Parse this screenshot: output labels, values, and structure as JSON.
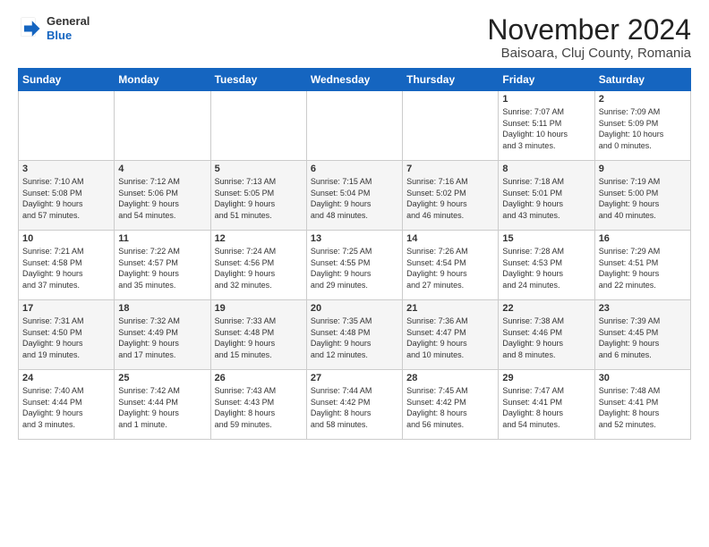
{
  "logo": {
    "line1": "General",
    "line2": "Blue"
  },
  "title": "November 2024",
  "subtitle": "Baisoara, Cluj County, Romania",
  "weekdays": [
    "Sunday",
    "Monday",
    "Tuesday",
    "Wednesday",
    "Thursday",
    "Friday",
    "Saturday"
  ],
  "weeks": [
    [
      {
        "day": "",
        "info": ""
      },
      {
        "day": "",
        "info": ""
      },
      {
        "day": "",
        "info": ""
      },
      {
        "day": "",
        "info": ""
      },
      {
        "day": "",
        "info": ""
      },
      {
        "day": "1",
        "info": "Sunrise: 7:07 AM\nSunset: 5:11 PM\nDaylight: 10 hours\nand 3 minutes."
      },
      {
        "day": "2",
        "info": "Sunrise: 7:09 AM\nSunset: 5:09 PM\nDaylight: 10 hours\nand 0 minutes."
      }
    ],
    [
      {
        "day": "3",
        "info": "Sunrise: 7:10 AM\nSunset: 5:08 PM\nDaylight: 9 hours\nand 57 minutes."
      },
      {
        "day": "4",
        "info": "Sunrise: 7:12 AM\nSunset: 5:06 PM\nDaylight: 9 hours\nand 54 minutes."
      },
      {
        "day": "5",
        "info": "Sunrise: 7:13 AM\nSunset: 5:05 PM\nDaylight: 9 hours\nand 51 minutes."
      },
      {
        "day": "6",
        "info": "Sunrise: 7:15 AM\nSunset: 5:04 PM\nDaylight: 9 hours\nand 48 minutes."
      },
      {
        "day": "7",
        "info": "Sunrise: 7:16 AM\nSunset: 5:02 PM\nDaylight: 9 hours\nand 46 minutes."
      },
      {
        "day": "8",
        "info": "Sunrise: 7:18 AM\nSunset: 5:01 PM\nDaylight: 9 hours\nand 43 minutes."
      },
      {
        "day": "9",
        "info": "Sunrise: 7:19 AM\nSunset: 5:00 PM\nDaylight: 9 hours\nand 40 minutes."
      }
    ],
    [
      {
        "day": "10",
        "info": "Sunrise: 7:21 AM\nSunset: 4:58 PM\nDaylight: 9 hours\nand 37 minutes."
      },
      {
        "day": "11",
        "info": "Sunrise: 7:22 AM\nSunset: 4:57 PM\nDaylight: 9 hours\nand 35 minutes."
      },
      {
        "day": "12",
        "info": "Sunrise: 7:24 AM\nSunset: 4:56 PM\nDaylight: 9 hours\nand 32 minutes."
      },
      {
        "day": "13",
        "info": "Sunrise: 7:25 AM\nSunset: 4:55 PM\nDaylight: 9 hours\nand 29 minutes."
      },
      {
        "day": "14",
        "info": "Sunrise: 7:26 AM\nSunset: 4:54 PM\nDaylight: 9 hours\nand 27 minutes."
      },
      {
        "day": "15",
        "info": "Sunrise: 7:28 AM\nSunset: 4:53 PM\nDaylight: 9 hours\nand 24 minutes."
      },
      {
        "day": "16",
        "info": "Sunrise: 7:29 AM\nSunset: 4:51 PM\nDaylight: 9 hours\nand 22 minutes."
      }
    ],
    [
      {
        "day": "17",
        "info": "Sunrise: 7:31 AM\nSunset: 4:50 PM\nDaylight: 9 hours\nand 19 minutes."
      },
      {
        "day": "18",
        "info": "Sunrise: 7:32 AM\nSunset: 4:49 PM\nDaylight: 9 hours\nand 17 minutes."
      },
      {
        "day": "19",
        "info": "Sunrise: 7:33 AM\nSunset: 4:48 PM\nDaylight: 9 hours\nand 15 minutes."
      },
      {
        "day": "20",
        "info": "Sunrise: 7:35 AM\nSunset: 4:48 PM\nDaylight: 9 hours\nand 12 minutes."
      },
      {
        "day": "21",
        "info": "Sunrise: 7:36 AM\nSunset: 4:47 PM\nDaylight: 9 hours\nand 10 minutes."
      },
      {
        "day": "22",
        "info": "Sunrise: 7:38 AM\nSunset: 4:46 PM\nDaylight: 9 hours\nand 8 minutes."
      },
      {
        "day": "23",
        "info": "Sunrise: 7:39 AM\nSunset: 4:45 PM\nDaylight: 9 hours\nand 6 minutes."
      }
    ],
    [
      {
        "day": "24",
        "info": "Sunrise: 7:40 AM\nSunset: 4:44 PM\nDaylight: 9 hours\nand 3 minutes."
      },
      {
        "day": "25",
        "info": "Sunrise: 7:42 AM\nSunset: 4:44 PM\nDaylight: 9 hours\nand 1 minute."
      },
      {
        "day": "26",
        "info": "Sunrise: 7:43 AM\nSunset: 4:43 PM\nDaylight: 8 hours\nand 59 minutes."
      },
      {
        "day": "27",
        "info": "Sunrise: 7:44 AM\nSunset: 4:42 PM\nDaylight: 8 hours\nand 58 minutes."
      },
      {
        "day": "28",
        "info": "Sunrise: 7:45 AM\nSunset: 4:42 PM\nDaylight: 8 hours\nand 56 minutes."
      },
      {
        "day": "29",
        "info": "Sunrise: 7:47 AM\nSunset: 4:41 PM\nDaylight: 8 hours\nand 54 minutes."
      },
      {
        "day": "30",
        "info": "Sunrise: 7:48 AM\nSunset: 4:41 PM\nDaylight: 8 hours\nand 52 minutes."
      }
    ]
  ]
}
